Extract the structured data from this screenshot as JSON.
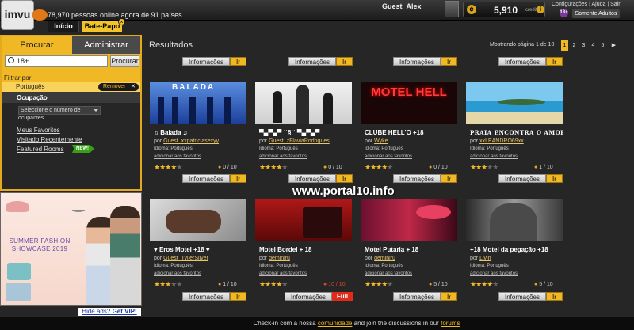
{
  "header": {
    "logo_text": "imvu",
    "online_text": "78,970 pessoas online agora de 91 países",
    "tab_home": "Início",
    "tab_chat": "Bate-Papo",
    "tab_close": "×",
    "username": "Guest_Alex",
    "credits_amount": "5,910",
    "credits_label": "credits",
    "credits_coin": "¢",
    "credits_info": "i",
    "links": [
      "Configurações",
      "Ajuda",
      "Sair"
    ],
    "age_badge": "18+",
    "adults_only": "Somente Adultos"
  },
  "search": {
    "tab_search": "Procurar",
    "tab_admin": "Administrar",
    "query": "18+",
    "button": "Procurar",
    "filter_label": "Filtrar por:",
    "filter_value": "Português",
    "remove_label": "Remover",
    "remove_x": "✕",
    "occupancy_label": "Ocupação",
    "occupancy_select_line1": "Seleccione o número de",
    "occupancy_select_line2": "ocupantes",
    "link_favorites": "Meus Favoritos",
    "link_recent": "Visitado Recentemente",
    "link_featured": "Featured Rooms",
    "new_badge": "NEW!"
  },
  "ad": {
    "title": "SUMMER FASHION SHOWCASE 2019",
    "hide_prefix": "Hide ads?",
    "hide_link": "Get VIP!"
  },
  "results": {
    "title": "Resultados",
    "page_text": "Mostrando página 1 de 10",
    "pages": [
      "1",
      "2",
      "3",
      "4",
      "5"
    ],
    "next": "▶",
    "current_page": "1",
    "info_label": "Informações",
    "go_label": "Ir",
    "full_label": "Full",
    "by_label": "por",
    "lang_label": "Idioma: Português",
    "fav_label": "adicionar aos favoritos",
    "rooms": [
      {
        "title": "♫ Balada ♫",
        "owner": "Guest_xxpatriciasexyy",
        "rating": 4,
        "occupancy": "0 / 10",
        "thumb_text": "BALADA"
      },
      {
        "title": "▀▄▀▄▀ ʿʿ§ʿʿ ▀▄▀▄▀",
        "owner": "Guest_zFlaviaRodrigues",
        "rating": 4,
        "occupancy": "0 / 10",
        "thumb_text": ""
      },
      {
        "title": "CLUBE HELL'O +18",
        "owner": "Wyke",
        "rating": 4,
        "occupancy": "0 / 10",
        "thumb_text": "MOTEL HELL"
      },
      {
        "title": "PRAIA ENCONTRA O AMOR",
        "owner": "xxLEANDRO69xx",
        "rating": 3,
        "occupancy": "1 / 10",
        "thumb_text": ""
      },
      {
        "title": "♥ Eros Motel +18 ♥",
        "owner": "Guest_TyllerSilver",
        "rating": 3,
        "occupancy": "1 / 10",
        "thumb_text": ""
      },
      {
        "title": "Motel Bordel + 18",
        "owner": "geminiru",
        "rating": 4,
        "occupancy": "10 / 10",
        "thumb_text": "",
        "full": true
      },
      {
        "title": "Motel Putaria + 18",
        "owner": "geminiru",
        "rating": 4,
        "occupancy": "5 / 10",
        "thumb_text": ""
      },
      {
        "title": "+18 Motel da pegação +18",
        "owner": "Livin",
        "rating": 4,
        "occupancy": "5 / 10",
        "thumb_text": ""
      }
    ]
  },
  "watermark": "www.portal10.info",
  "footer": {
    "prefix": "Check-in com a nossa",
    "link1": "comunidade",
    "middle": "and join the discussions in our",
    "link2": "forums"
  }
}
